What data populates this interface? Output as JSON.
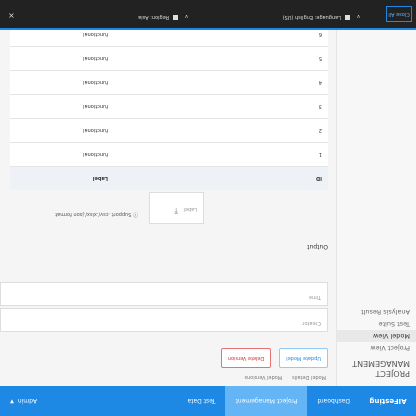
{
  "nav": {
    "brand": "AIFesting",
    "tabs": [
      "Dashboard",
      "Project Management",
      "Test Data"
    ],
    "user": "Admin"
  },
  "sidebar": {
    "heading1": "PROJECT",
    "heading2": "MANAGEMENT",
    "items": [
      "Project View",
      "Model View",
      "Test Suite",
      "Analysis Result"
    ]
  },
  "main": {
    "tabs": [
      "Model Details",
      "Model Versions"
    ],
    "actions": {
      "update": "Update Model",
      "delete": "Delete Version"
    },
    "fields": {
      "creator": "Creator",
      "time": "Time"
    },
    "section_label": "Output",
    "upload": {
      "label": "Label"
    },
    "hint": "Support .csv/.xlsx/.json format",
    "table": {
      "headers": [
        "ID",
        "Label"
      ],
      "rows": [
        {
          "id": "1",
          "label": "functional"
        },
        {
          "id": "2",
          "label": "functional"
        },
        {
          "id": "3",
          "label": "functional"
        },
        {
          "id": "4",
          "label": "functional"
        },
        {
          "id": "5",
          "label": "functional"
        },
        {
          "id": "6",
          "label": "functional"
        }
      ]
    }
  },
  "bottombar": {
    "button": "Close All",
    "select1": "Language: English (US)",
    "select2": "Region: Asia"
  }
}
